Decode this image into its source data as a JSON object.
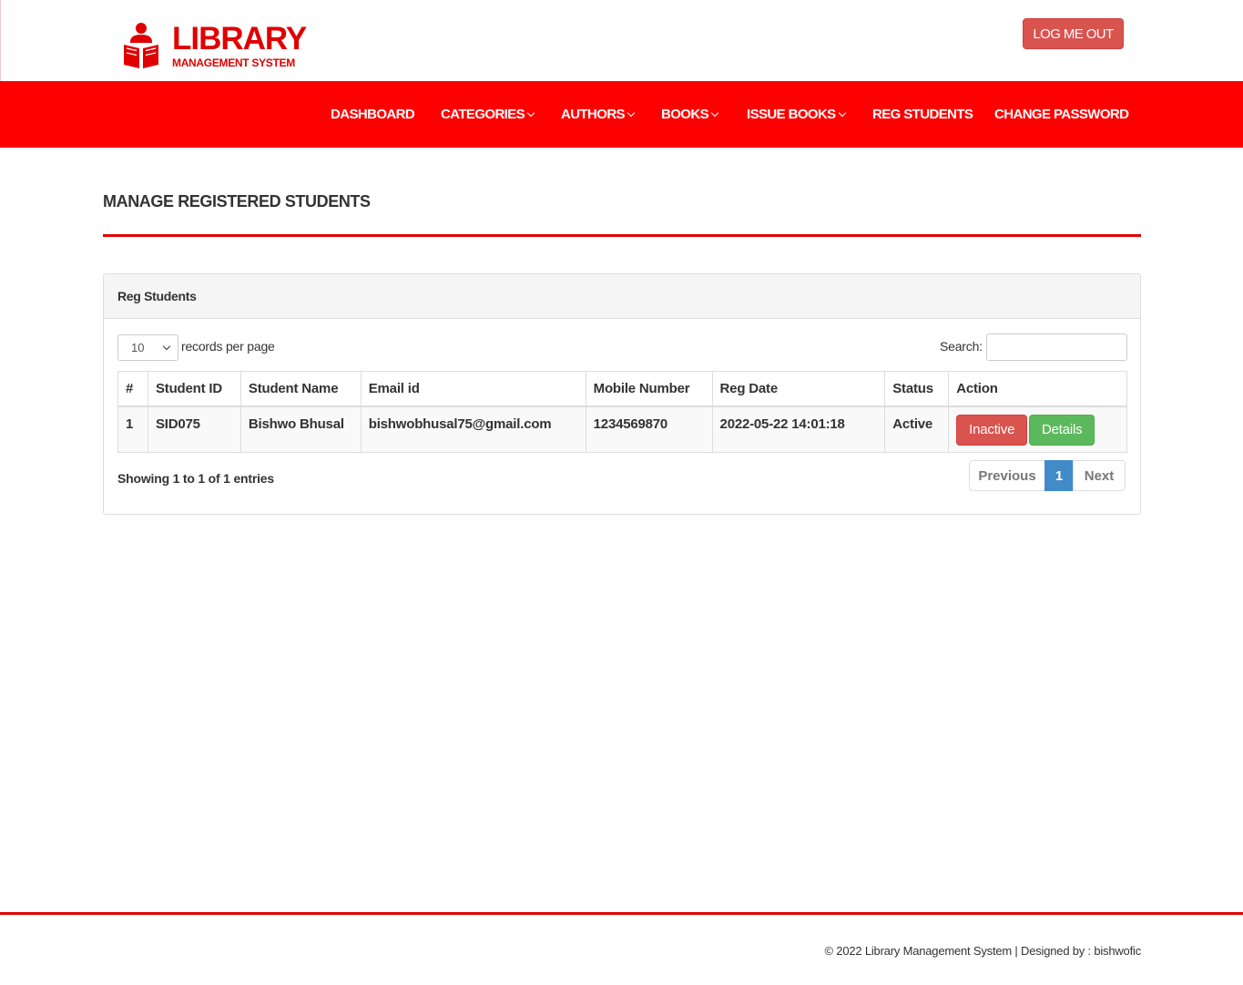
{
  "brand": {
    "title": "LIBRARY",
    "subtitle": "MANAGEMENT SYSTEM",
    "icon": "reader-book-icon",
    "color": "#e00000"
  },
  "header": {
    "logout_label": "LOG ME OUT"
  },
  "nav": {
    "items": [
      {
        "label": "DASHBOARD",
        "dropdown": false
      },
      {
        "label": "CATEGORIES",
        "dropdown": true
      },
      {
        "label": "AUTHORS",
        "dropdown": true
      },
      {
        "label": "BOOKS",
        "dropdown": true
      },
      {
        "label": "ISSUE BOOKS",
        "dropdown": true
      },
      {
        "label": "REG STUDENTS",
        "dropdown": false
      },
      {
        "label": "CHANGE PASSWORD",
        "dropdown": false
      }
    ],
    "background": "#ff0000"
  },
  "page": {
    "title": "MANAGE REGISTERED STUDENTS"
  },
  "panel": {
    "heading": "Reg Students",
    "length_value": "10",
    "length_label": "records per page",
    "search_label": "Search:",
    "search_value": ""
  },
  "table": {
    "columns": [
      "#",
      "Student ID",
      "Student Name",
      "Email id",
      "Mobile Number",
      "Reg Date",
      "Status",
      "Action"
    ],
    "rows": [
      {
        "num": "1",
        "student_id": "SID075",
        "name": "Bishwo Bhusal",
        "email": "bishwobhusal75@gmail.com",
        "mobile": "1234569870",
        "reg_date": "2022-05-22 14:01:18",
        "status": "Active",
        "action_primary": "Inactive",
        "action_secondary": "Details"
      }
    ]
  },
  "footer_info": {
    "showing": "Showing 1 to 1 of 1 entries",
    "prev": "Previous",
    "page": "1",
    "next": "Next"
  },
  "footer": {
    "text": "© 2022 Library Management System | Designed by : bishwofic"
  }
}
